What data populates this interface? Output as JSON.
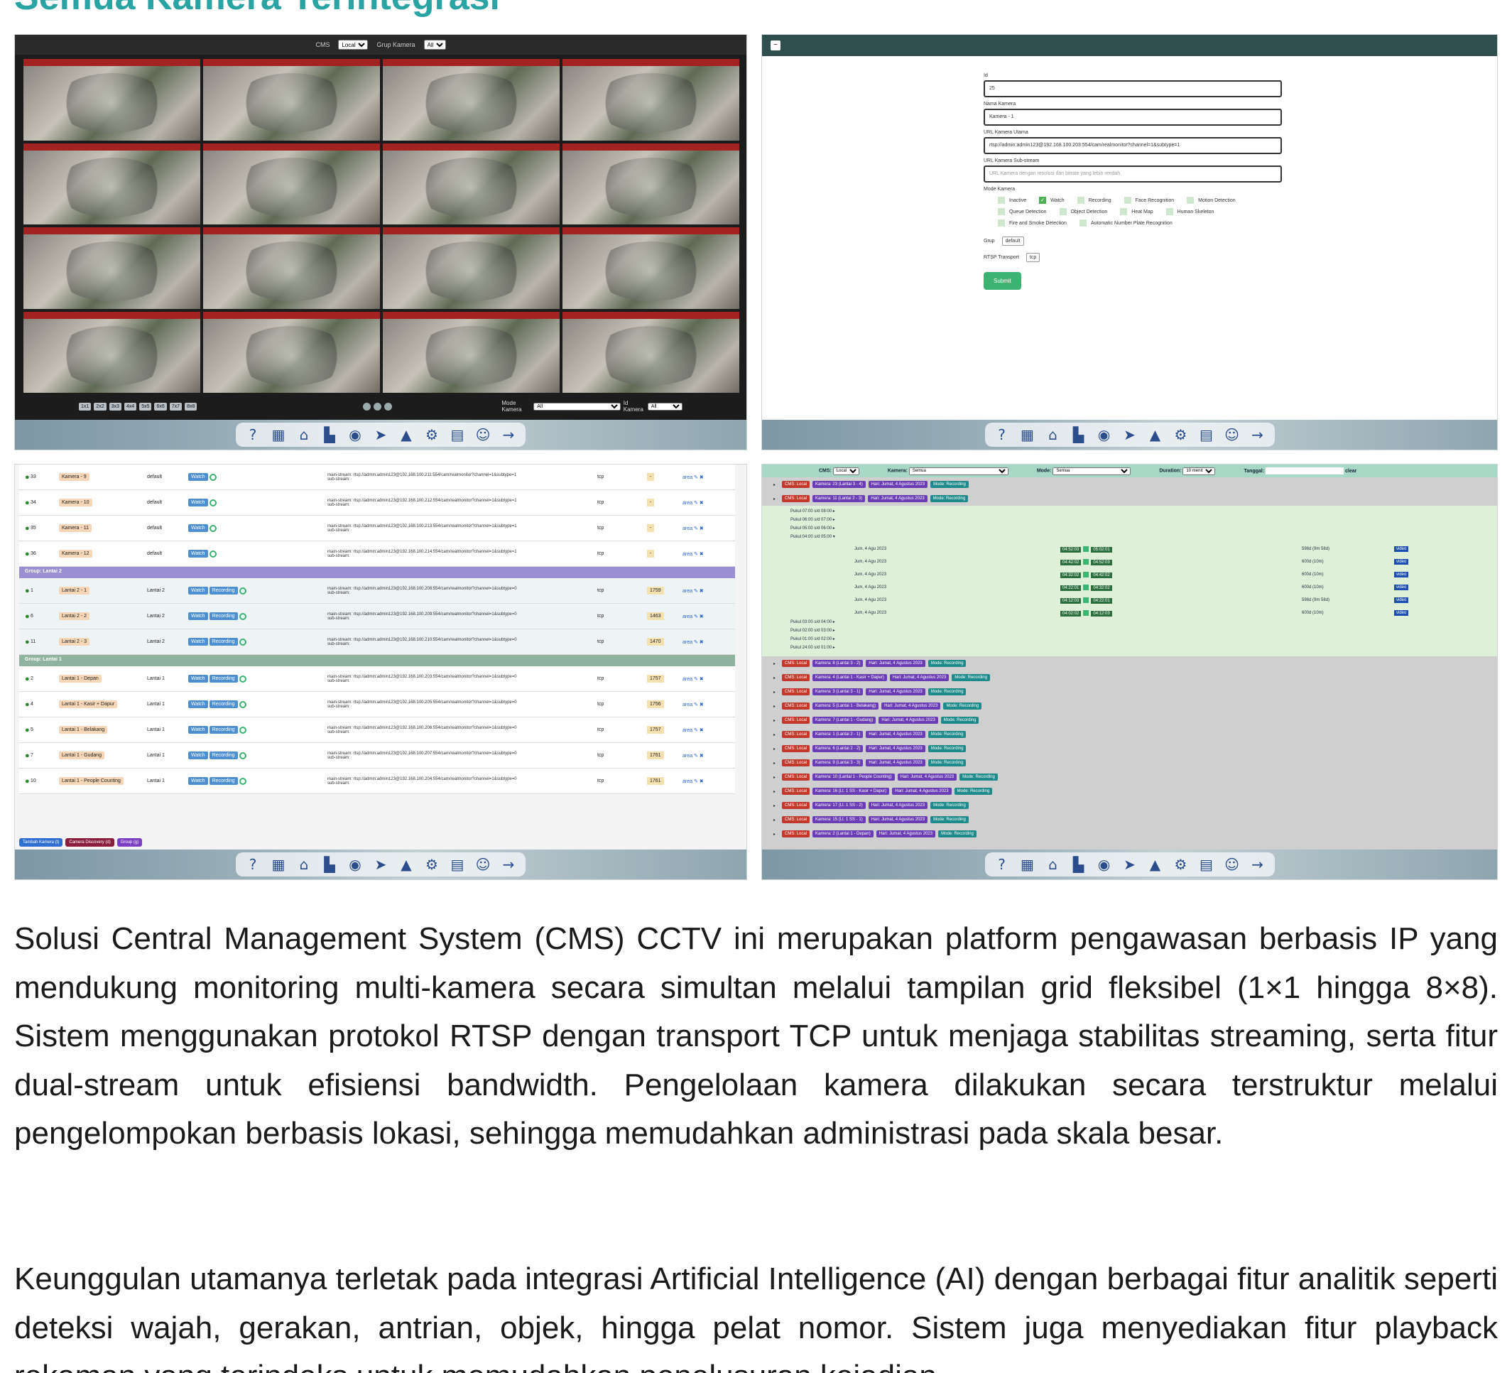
{
  "heading_fragment": "Semua Kamera Terintegrasi",
  "dock_icons": [
    "help-icon",
    "grid-icon",
    "home-icon",
    "chart-icon",
    "camera-icon",
    "arrow-icon",
    "warning-icon",
    "gear-icon",
    "storage-icon",
    "user-icon",
    "logout-icon"
  ],
  "panel1": {
    "cms_label": "CMS",
    "cms_value": "Local",
    "group_label": "Grup Kamera",
    "group_value": "All",
    "cameras": [
      "WA1 - Lantai 2 - 1",
      "WA2 - Lantai 1 - Depan",
      "WA3 - Lantai 2 - 2",
      "WA4 - Lantai 1 - Kasir",
      "WA5 - Lantai 1 - Belakang",
      "WA6 - Lantai 2 - 3",
      "WA7 - Lantai 1 - Gudang",
      "WA8 - Lantai 2 - 3",
      "WA9 - Lt. 2 - 3",
      "WA10 - Lantai 1 - People",
      "WA11 - Lt. 2 Sit - 1",
      "WA12 - Lt. 2 Sit - 2",
      "WA13 - Lt. 2 Sit - 3",
      "WA14 - Lt. 2 Sit - 4",
      "WA15 - Lt. 1 SS - 1",
      "WA16 - Lt. 1 SS - Kasir"
    ],
    "layouts": [
      "1x1",
      "2x2",
      "3x3",
      "4x4",
      "5x5",
      "6x6",
      "7x7",
      "8x8"
    ],
    "mode_label": "Mode Kamera",
    "mode_value": "All",
    "id_label": "Id Kamera",
    "id_value": "All"
  },
  "panel2": {
    "id_label": "Id",
    "id_value": "25",
    "name_label": "Nama Kamera",
    "name_value": "Kamera - 1",
    "url_label": "URL Kamera Utama",
    "url_value": "rtsp://admin:admin123@192.168.100.203:554/cam/realmonitor?channel=1&subtype=1",
    "sub_label": "URL Kamera Sub-stream",
    "sub_placeholder": "URL Kamera dengan resolusi dan bitrate yang lebih rendah.",
    "mode_label": "Mode Kamera",
    "modes": [
      {
        "name": "Inactive",
        "on": false
      },
      {
        "name": "Watch",
        "on": true
      },
      {
        "name": "Recording",
        "on": false
      },
      {
        "name": "Face Recognition",
        "on": false
      },
      {
        "name": "Motion Detection",
        "on": false
      },
      {
        "name": "Queue Detection",
        "on": false
      },
      {
        "name": "Object Detection",
        "on": false
      },
      {
        "name": "Heat Map",
        "on": false
      },
      {
        "name": "Human Skeleton",
        "on": false
      },
      {
        "name": "Fire and Smoke Detection",
        "on": false
      },
      {
        "name": "Automatic Number Plate Recognition",
        "on": false
      }
    ],
    "group_label": "Grup",
    "group_value": "default",
    "rtsp_label": "RTSP Transport",
    "rtsp_value": "tcp",
    "submit_label": "Submit"
  },
  "panel3": {
    "rows_top": [
      {
        "id": "33",
        "name": "Kamera - 9",
        "group": "default",
        "mode": [
          "Watch"
        ],
        "url": "main-stream: rtsp://admin:admin123@192.168.100.211:554/cam/realmonitor?channel=1&subtype=1",
        "tr": "tcp",
        "n": "-"
      },
      {
        "id": "34",
        "name": "Kamera - 10",
        "group": "default",
        "mode": [
          "Watch"
        ],
        "url": "main-stream: rtsp://admin:admin123@192.168.100.212:554/cam/realmonitor?channel=1&subtype=1",
        "tr": "tcp",
        "n": "-"
      },
      {
        "id": "35",
        "name": "Kamera - 11",
        "group": "default",
        "mode": [
          "Watch"
        ],
        "url": "main-stream: rtsp://admin:admin123@192.168.100.213:554/cam/realmonitor?channel=1&subtype=1",
        "tr": "tcp",
        "n": "-"
      },
      {
        "id": "36",
        "name": "Kamera - 12",
        "group": "default",
        "mode": [
          "Watch"
        ],
        "url": "main-stream: rtsp://admin:admin123@192.168.100.214:554/cam/realmonitor?channel=1&subtype=1",
        "tr": "tcp",
        "n": "-"
      }
    ],
    "group2_label": "Group: Lantai 2",
    "rows_g2": [
      {
        "id": "1",
        "name": "Lantai 2 - 1",
        "group": "Lantai 2",
        "mode": [
          "Watch",
          "Recording"
        ],
        "url": "main-stream: rtsp://admin:admin123@192.168.100.208:554/cam/realmonitor?channel=1&subtype=0",
        "tr": "tcp",
        "n": "1759"
      },
      {
        "id": "6",
        "name": "Lantai 2 - 2",
        "group": "Lantai 2",
        "mode": [
          "Watch",
          "Recording"
        ],
        "url": "main-stream: rtsp://admin:admin123@192.168.100.209:554/cam/realmonitor?channel=1&subtype=0",
        "tr": "tcp",
        "n": "1463"
      },
      {
        "id": "11",
        "name": "Lantai 2 - 3",
        "group": "Lantai 2",
        "mode": [
          "Watch",
          "Recording"
        ],
        "url": "main-stream: rtsp://admin:admin123@192.168.100.210:554/cam/realmonitor?channel=1&subtype=0",
        "tr": "tcp",
        "n": "1470"
      }
    ],
    "group1_label": "Group: Lantai 1",
    "rows_g1": [
      {
        "id": "2",
        "name": "Lantai 1 - Depan",
        "group": "Lantai 1",
        "mode": [
          "Watch",
          "Recording"
        ],
        "url": "main-stream: rtsp://admin:admin123@192.168.100.203:554/cam/realmonitor?channel=1&subtype=0",
        "tr": "tcp",
        "n": "1757"
      },
      {
        "id": "4",
        "name": "Lantai 1 - Kasir + Dapur",
        "group": "Lantai 1",
        "mode": [
          "Watch",
          "Recording"
        ],
        "url": "main-stream: rtsp://admin:admin123@192.168.100.205:554/cam/realmonitor?channel=1&subtype=0",
        "tr": "tcp",
        "n": "1756"
      },
      {
        "id": "5",
        "name": "Lantai 1 - Belakang",
        "group": "Lantai 1",
        "mode": [
          "Watch",
          "Recording"
        ],
        "url": "main-stream: rtsp://admin:admin123@192.168.100.206:554/cam/realmonitor?channel=1&subtype=0",
        "tr": "tcp",
        "n": "1757"
      },
      {
        "id": "7",
        "name": "Lantai 1 - Gudang",
        "group": "Lantai 1",
        "mode": [
          "Watch",
          "Recording"
        ],
        "url": "main-stream: rtsp://admin:admin123@192.168.100.207:554/cam/realmonitor?channel=1&subtype=0",
        "tr": "tcp",
        "n": "1761"
      },
      {
        "id": "10",
        "name": "Lantai 1 - People Counting",
        "group": "Lantai 1",
        "mode": [
          "Watch",
          "Recording"
        ],
        "url": "main-stream: rtsp://admin:admin123@192.168.100.204:554/cam/realmonitor?channel=1&subtype=0",
        "tr": "tcp",
        "n": "1761"
      }
    ],
    "sub_stream": "sub-stream:",
    "action_label": "area",
    "buttons": [
      {
        "label": "Tambah Kamera (t)",
        "color": "#2e6fd1"
      },
      {
        "label": "Camera Discovery (d)",
        "color": "#8b1e3f"
      },
      {
        "label": "Group (g)",
        "color": "#7b3fc4"
      }
    ]
  },
  "panel4": {
    "cms_label": "CMS:",
    "cms_value": "Local",
    "camera_label": "Kamera:",
    "camera_value": "Semua",
    "mode_label": "Mode:",
    "mode_value": "Semua",
    "duration_label": "Duration:",
    "duration_value": "10 menit",
    "date_label": "Tanggal:",
    "clear_label": "clear",
    "top_rows": [
      {
        "cam": "Kamera: 23 (Lantai 3 - 4)",
        "day": "Hari: Jumat, 4 Agustus 2023",
        "mode": "Mode: Recording"
      },
      {
        "cam": "Kamera: 11 (Lantai 2 - 3)",
        "day": "Hari: Jumat, 4 Agustus 2023",
        "mode": "Mode: Recording"
      }
    ],
    "hours_before": [
      "Pukul 07:00 s/d 08:00 ▸",
      "Pukul 06:00 s/d 07:00 ▸",
      "Pukul 05:00 s/d 06:00 ▸"
    ],
    "hour_open": "Pukul 04:00 s/d 05:00 ▾",
    "recs": [
      {
        "date": "Jum, 4 Agu 2023",
        "start": "04:52:03",
        "end": "05:02:01",
        "size": "598d (9m 58d)"
      },
      {
        "date": "Jum, 4 Agu 2023",
        "start": "04:42:02",
        "end": "04:52:03",
        "size": "600d (10m)"
      },
      {
        "date": "Jum, 4 Agu 2023",
        "start": "04:32:02",
        "end": "04:42:02",
        "size": "600d (10m)"
      },
      {
        "date": "Jum, 4 Agu 2023",
        "start": "04:22:01",
        "end": "04:32:02",
        "size": "600d (10m)"
      },
      {
        "date": "Jum, 4 Agu 2023",
        "start": "04:12:03",
        "end": "04:22:01",
        "size": "598d (9m 58d)"
      },
      {
        "date": "Jum, 4 Agu 2023",
        "start": "04:02:02",
        "end": "04:12:03",
        "size": "600d (10m)"
      }
    ],
    "video_label": "video",
    "hours_after": [
      "Pukul 03:00 s/d 04:00 ▸",
      "Pukul 02:00 s/d 03:00 ▸",
      "Pukul 01:00 s/d 02:00 ▸",
      "Pukul 24:00 s/d 01:00 ▸"
    ],
    "rows": [
      {
        "cam": "Kamera: 8 (Lantai 3 - 2)",
        "day": "Hari: Jumat, 4 Agustus 2023",
        "mode": "Mode: Recording"
      },
      {
        "cam": "Kamera: 4 (Lantai 1 - Kasir + Dapur)",
        "day": "Hari: Jumat, 4 Agustus 2023",
        "mode": "Mode: Recording"
      },
      {
        "cam": "Kamera: 3 (Lantai 3 - 1)",
        "day": "Hari: Jumat, 4 Agustus 2023",
        "mode": "Mode: Recording"
      },
      {
        "cam": "Kamera: 5 (Lantai 1 - Belakang)",
        "day": "Hari: Jumat, 4 Agustus 2023",
        "mode": "Mode: Recording"
      },
      {
        "cam": "Kamera: 7 (Lantai 1 - Gudang)",
        "day": "Hari: Jumat, 4 Agustus 2023",
        "mode": "Mode: Recording"
      },
      {
        "cam": "Kamera: 1 (Lantai 2 - 1)",
        "day": "Hari: Jumat, 4 Agustus 2023",
        "mode": "Mode: Recording"
      },
      {
        "cam": "Kamera: 6 (Lantai 2 - 2)",
        "day": "Hari: Jumat, 4 Agustus 2023",
        "mode": "Mode: Recording"
      },
      {
        "cam": "Kamera: 9 (Lantai 3 - 3)",
        "day": "Hari: Jumat, 4 Agustus 2023",
        "mode": "Mode: Recording"
      },
      {
        "cam": "Kamera: 10 (Lantai 1 - People Counting)",
        "day": "Hari: Jumat, 4 Agustus 2023",
        "mode": "Mode: Recording"
      },
      {
        "cam": "Kamera: 16 (Lt. 1 SS - Kasir + Dapur)",
        "day": "Hari: Jumat, 4 Agustus 2023",
        "mode": "Mode: Recording"
      },
      {
        "cam": "Kamera: 17 (Lt. 1 SS - 2)",
        "day": "Hari: Jumat, 4 Agustus 2023",
        "mode": "Mode: Recording"
      },
      {
        "cam": "Kamera: 15 (Lt. 1 SS - 1)",
        "day": "Hari: Jumat, 4 Agustus 2023",
        "mode": "Mode: Recording"
      },
      {
        "cam": "Kamera: 2 (Lantai 1 - Depan)",
        "day": "Hari: Jumat, 4 Agustus 2023",
        "mode": "Mode: Recording"
      }
    ]
  },
  "para1": "Solusi Central Management System (CMS) CCTV ini merupakan platform pengawasan berbasis IP yang mendukung monitoring multi-kamera secara simultan melalui tampilan grid fleksibel (1×1 hingga 8×8). Sistem menggunakan protokol RTSP dengan transport TCP untuk menjaga stabilitas streaming, serta fitur dual-stream untuk efisiensi bandwidth. Pengelolaan kamera dilakukan secara terstruktur melalui pengelompokan berbasis lokasi, sehingga memudahkan administrasi pada skala besar.",
  "para2": "Keunggulan utamanya terletak pada integrasi Artificial Intelligence (AI) dengan berbagai fitur analitik seperti deteksi wajah, gerakan, antrian, objek, hingga pelat nomor. Sistem juga menyediakan fitur playback rekaman yang terindeks untuk memudahkan penelusuran kejadian."
}
